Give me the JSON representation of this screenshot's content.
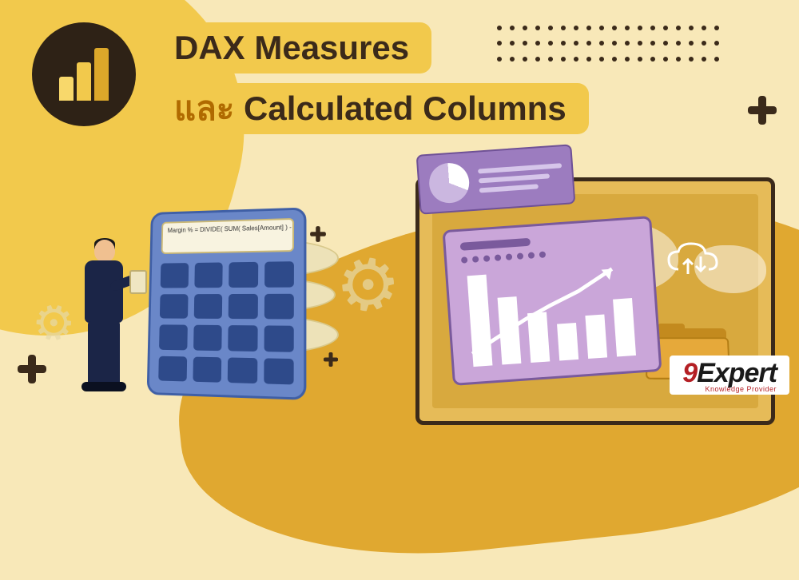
{
  "title": {
    "line1": "DAX Measures",
    "line2_a": "และ",
    "line2_b": "Calculated Columns"
  },
  "calculator": {
    "formula": "Margin % = DIVIDE( SUM( Sales[Amount] ) - SUM..."
  },
  "brand": {
    "nine": "9",
    "name": "Expert",
    "tagline": "Knowledge Provider"
  },
  "bar_card": {
    "bars_pct": [
      95,
      70,
      52,
      38,
      45,
      60
    ]
  },
  "icons": {
    "pbi": "power-bi-logo",
    "cloud": "cloud-sync-icon",
    "folder": "folder-icon",
    "gear": "gear-icon",
    "plus": "plus-decoration"
  }
}
